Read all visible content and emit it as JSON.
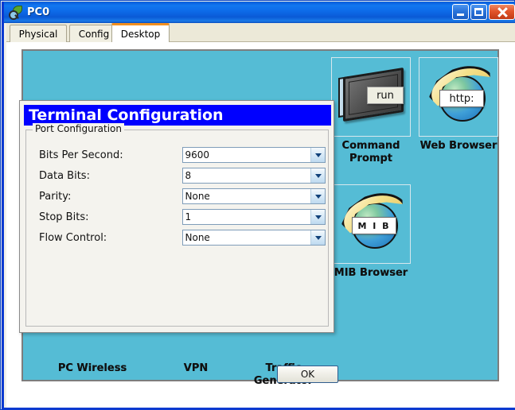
{
  "window": {
    "title": "PC0",
    "icon": "magnifier-leaf-icon",
    "buttons": {
      "minimize": "minimize-button",
      "maximize": "maximize-button",
      "close": "close-button"
    }
  },
  "tabs": [
    {
      "label": "Physical",
      "active": false
    },
    {
      "label": "Config",
      "active": false
    },
    {
      "label": "Desktop",
      "active": true
    }
  ],
  "desktop": {
    "background_color": "#55bcd5",
    "icons": [
      {
        "label": "Command Prompt",
        "art": "monitor-run-icon",
        "badge": "run"
      },
      {
        "label": "Web Browser",
        "art": "globe-http-icon",
        "badge": "http:"
      },
      {
        "label": "MIB Browser",
        "art": "globe-mib-icon",
        "badge": "M I B"
      }
    ],
    "obscured_labels": [
      {
        "label": "PC Wireless"
      },
      {
        "label": "VPN"
      },
      {
        "label": "Traffic Generator"
      }
    ]
  },
  "dialog": {
    "title": "Terminal Configuration",
    "title_bg": "#0000ff",
    "group_legend": "Port Configuration",
    "fields": [
      {
        "label": "Bits Per Second:",
        "value": "9600"
      },
      {
        "label": "Data Bits:",
        "value": "8"
      },
      {
        "label": "Parity:",
        "value": "None"
      },
      {
        "label": "Stop Bits:",
        "value": "1"
      },
      {
        "label": "Flow Control:",
        "value": "None"
      }
    ],
    "ok_label": "OK"
  }
}
